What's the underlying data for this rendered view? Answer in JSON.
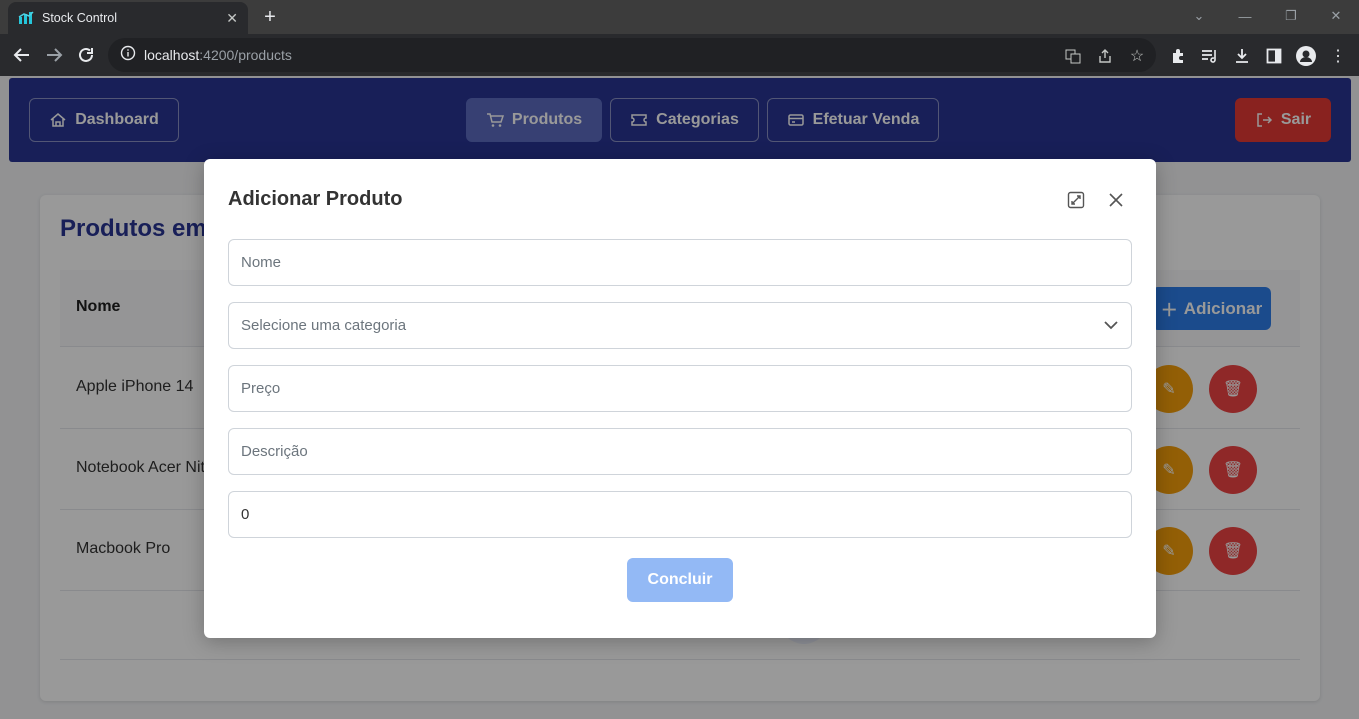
{
  "browser": {
    "tab_title": "Stock Control",
    "url_host": "localhost",
    "url_path": ":4200/products"
  },
  "nav": {
    "dashboard": "Dashboard",
    "produtos": "Produtos",
    "categorias": "Categorias",
    "efetuar_venda": "Efetuar Venda",
    "sair": "Sair"
  },
  "page": {
    "title": "Produtos em",
    "table_header_name": "Nome",
    "add_button": "Adicionar",
    "rows": [
      {
        "name": "Apple iPhone 14"
      },
      {
        "name": "Notebook Acer Nit"
      },
      {
        "name": "Macbook Pro"
      }
    ]
  },
  "dialog": {
    "title": "Adicionar Produto",
    "fields": {
      "nome_placeholder": "Nome",
      "categoria_placeholder": "Selecione uma categoria",
      "preco_placeholder": "Preço",
      "descricao_placeholder": "Descrição",
      "quantidade_value": "0"
    },
    "submit": "Concluir"
  },
  "colors": {
    "nav_bg": "#283593",
    "nav_active": "#5c6bc0",
    "danger": "#e53935",
    "primary": "#2e7de9",
    "warning": "#f59e0b",
    "submit_disabled": "#93b9f5"
  }
}
